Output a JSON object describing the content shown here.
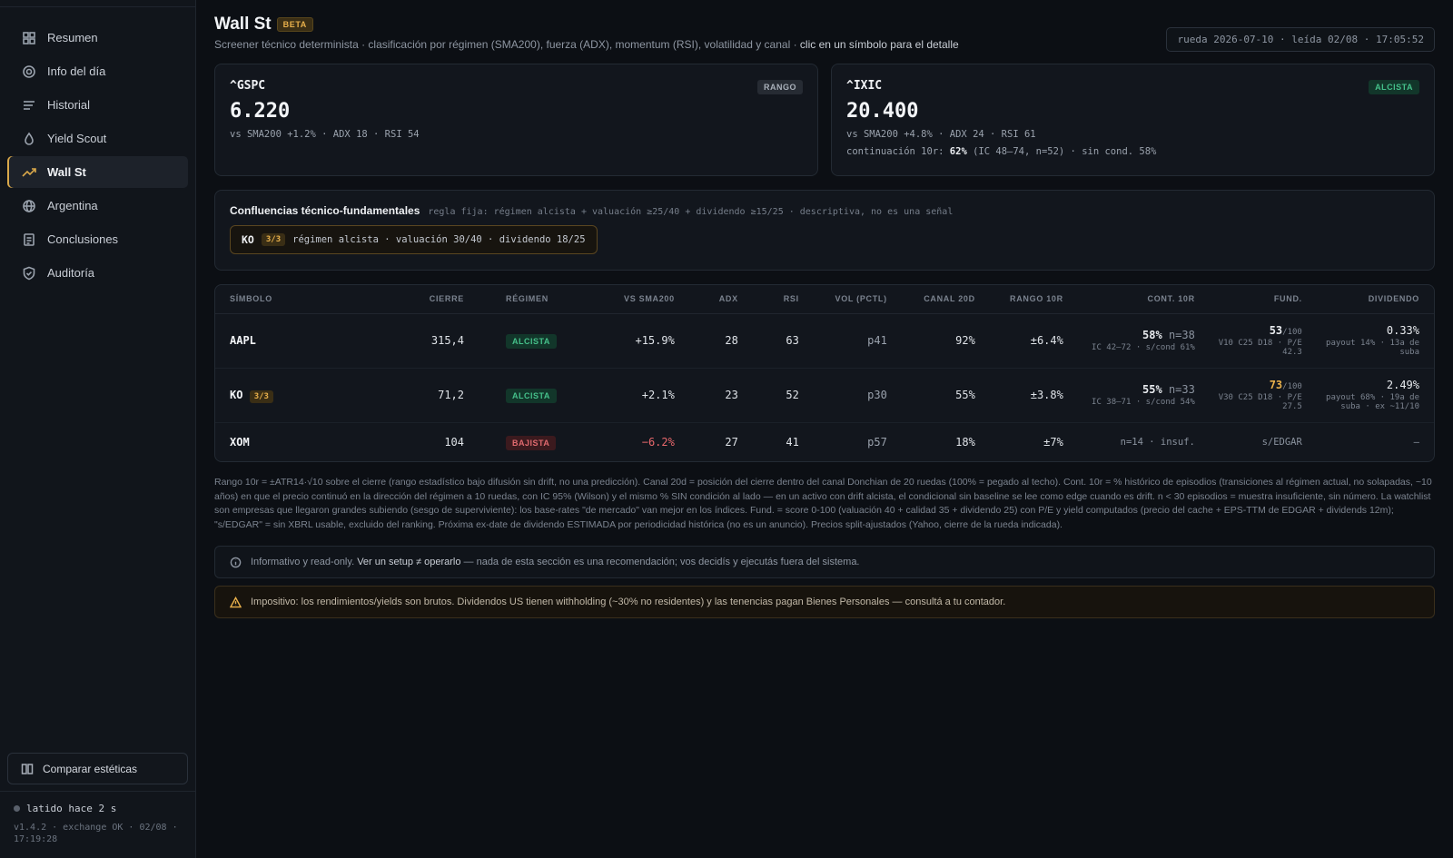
{
  "sidebar": {
    "items": [
      {
        "label": "Resumen",
        "icon": "grid-icon"
      },
      {
        "label": "Info del día",
        "icon": "target-icon"
      },
      {
        "label": "Historial",
        "icon": "list-icon"
      },
      {
        "label": "Yield Scout",
        "icon": "drop-icon"
      },
      {
        "label": "Wall St",
        "icon": "trend-up-icon",
        "active": true
      },
      {
        "label": "Argentina",
        "icon": "globe-icon"
      },
      {
        "label": "Conclusiones",
        "icon": "document-icon"
      },
      {
        "label": "Auditoría",
        "icon": "shield-icon"
      }
    ],
    "compare_label": "Comparar estéticas",
    "heartbeat": "latido hace 2 s",
    "version": "v1.4.2 · exchange OK · 02/08 · 17:19:28"
  },
  "header": {
    "title": "Wall St",
    "badge": "BETA",
    "subtitle": "Screener técnico determinista · clasificación por régimen (SMA200), fuerza (ADX), momentum (RSI), volatilidad y canal · ",
    "subtitle_hint": "clic en un símbolo para el detalle",
    "stamp": "rueda 2026-07-10 · leída 02/08 · 17:05:52"
  },
  "indices": [
    {
      "symbol": "^GSPC",
      "value": "6.220",
      "meta": "vs SMA200 +1.2% · ADX 18 · RSI 54",
      "regime": "RANGO"
    },
    {
      "symbol": "^IXIC",
      "value": "20.400",
      "meta": "vs SMA200 +4.8% · ADX 24 · RSI 61",
      "regime": "ALCISTA",
      "meta2_prefix": "continuación 10r: ",
      "meta2_bold": "62%",
      "meta2_suffix": " (IC 48–74, n=52) · sin cond. 58%"
    }
  ],
  "confluences": {
    "title": "Confluencias técnico-fundamentales",
    "rule": "regla fija: régimen alcista + valuación ≥25/40 + dividendo ≥15/25 · descriptiva, no es una señal",
    "chip": {
      "symbol": "KO",
      "score": "3/3",
      "desc": "régimen alcista · valuación 30/40 · dividendo 18/25"
    }
  },
  "table": {
    "headers": [
      "SÍMBOLO",
      "CIERRE",
      "RÉGIMEN",
      "VS SMA200",
      "ADX",
      "RSI",
      "VOL (PCTL)",
      "CANAL 20D",
      "RANGO 10R",
      "CONT. 10R",
      "FUND.",
      "DIVIDENDO"
    ],
    "rows": [
      {
        "symbol": "AAPL",
        "close": "315,4",
        "regime": "ALCISTA",
        "vs_sma": "+15.9%",
        "adx": "28",
        "rsi": "63",
        "vol": "p41",
        "canal": "92%",
        "rango": "±6.4%",
        "cont_pct": "58%",
        "cont_n": "n=38",
        "cont_sub": "IC 42–72 · s/cond 61%",
        "fund_score": "53",
        "fund_of": "/100",
        "fund_sub": "V10 C25 D18 · P/E 42.3",
        "div_main": "0.33%",
        "div_sub": "payout 14% · 13a de suba"
      },
      {
        "symbol": "KO",
        "badge": "3/3",
        "close": "71,2",
        "regime": "ALCISTA",
        "vs_sma": "+2.1%",
        "adx": "23",
        "rsi": "52",
        "vol": "p30",
        "canal": "55%",
        "rango": "±3.8%",
        "cont_pct": "55%",
        "cont_n": "n=33",
        "cont_sub": "IC 38–71 · s/cond 54%",
        "fund_score": "73",
        "fund_of": "/100",
        "fund_sub": "V30 C25 D18 · P/E 27.5",
        "div_main": "2.49%",
        "div_sub": "payout 68% · 19a de suba · ex ~11/10"
      },
      {
        "symbol": "XOM",
        "close": "104",
        "regime": "BAJISTA",
        "vs_sma": "−6.2%",
        "adx": "27",
        "rsi": "41",
        "vol": "p57",
        "canal": "18%",
        "rango": "±7%",
        "cont_text": "n=14 · insuf.",
        "fund_text": "s/EDGAR",
        "div_text": "—"
      }
    ]
  },
  "footnote": "Rango 10r = ±ATR14·√10 sobre el cierre (rango estadístico bajo difusión sin drift, no una predicción). Canal 20d = posición del cierre dentro del canal Donchian de 20 ruedas (100% = pegado al techo). Cont. 10r = % histórico de episodios (transiciones al régimen actual, no solapadas, ~10 años) en que el precio continuó en la dirección del régimen a 10 ruedas, con IC 95% (Wilson) y el mismo % SIN condición al lado — en un activo con drift alcista, el condicional sin baseline se lee como edge cuando es drift. n < 30 episodios = muestra insuficiente, sin número. La watchlist son empresas que llegaron grandes subiendo (sesgo de superviviente): los base-rates \"de mercado\" van mejor en los índices. Fund. = score 0-100 (valuación 40 + calidad 35 + dividendo 25) con P/E y yield computados (precio del cache + EPS-TTM de EDGAR + dividends 12m); \"s/EDGAR\" = sin XBRL usable, excluido del ranking. Próxima ex-date de dividendo ESTIMADA por periodicidad histórica (no es un anuncio). Precios split-ajustados (Yahoo, cierre de la rueda indicada).",
  "notice": {
    "prefix": "Informativo y read-only. ",
    "highlight": "Ver un setup ≠ operarlo",
    "suffix": " — nada de esta sección es una recomendación; vos decidís y ejecutás fuera del sistema."
  },
  "warning": "Impositivo: los rendimientos/yields son brutos. Dividendos US tienen withholding (~30% no residentes) y las tenencias pagan Bienes Personales — consultá a tu contador.",
  "colors": {
    "accent": "#d9a84a",
    "bull": "#45c08a",
    "bear": "#e06a6f",
    "bg": "#0c0f14"
  }
}
